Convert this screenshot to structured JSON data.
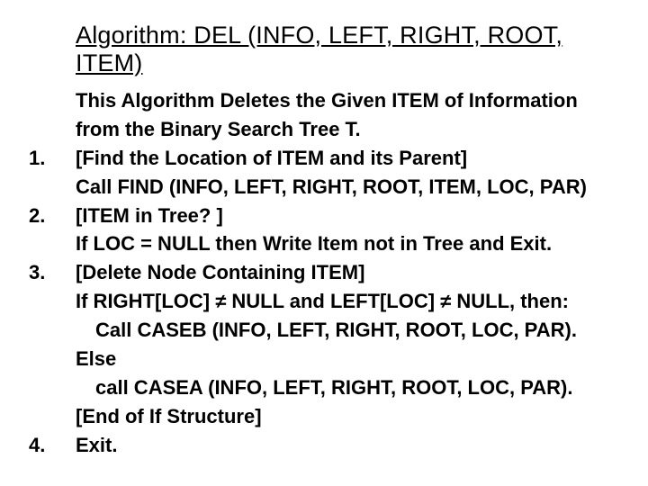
{
  "title": "Algorithm: DEL (INFO, LEFT, RIGHT, ROOT, ITEM)",
  "lines": [
    {
      "num": "",
      "text": "This Algorithm Deletes the Given ITEM of Information",
      "indent": false
    },
    {
      "num": "",
      "text": "from the Binary Search Tree T.",
      "indent": false
    },
    {
      "num": "1.",
      "text": "[Find the Location of ITEM and its Parent]",
      "indent": false
    },
    {
      "num": "",
      "text": "Call FIND (INFO, LEFT, RIGHT, ROOT, ITEM, LOC, PAR)",
      "indent": false
    },
    {
      "num": "2.",
      "text": "[ITEM in Tree? ]",
      "indent": false
    },
    {
      "num": "",
      "text": "If LOC = NULL then Write Item not in Tree and Exit.",
      "indent": false
    },
    {
      "num": "3.",
      "text": "[Delete Node Containing ITEM]",
      "indent": false
    },
    {
      "num": "",
      "text": "If RIGHT[LOC] ≠ NULL and LEFT[LOC] ≠ NULL, then:",
      "indent": false
    },
    {
      "num": "",
      "text": "Call CASEB (INFO, LEFT, RIGHT, ROOT, LOC, PAR).",
      "indent": true
    },
    {
      "num": "",
      "text": "Else",
      "indent": false
    },
    {
      "num": "",
      "text": "call CASEA (INFO, LEFT, RIGHT, ROOT, LOC, PAR).",
      "indent": true
    },
    {
      "num": "",
      "text": "[End of If Structure]",
      "indent": false
    },
    {
      "num": "4.",
      "text": "Exit.",
      "indent": false
    }
  ]
}
